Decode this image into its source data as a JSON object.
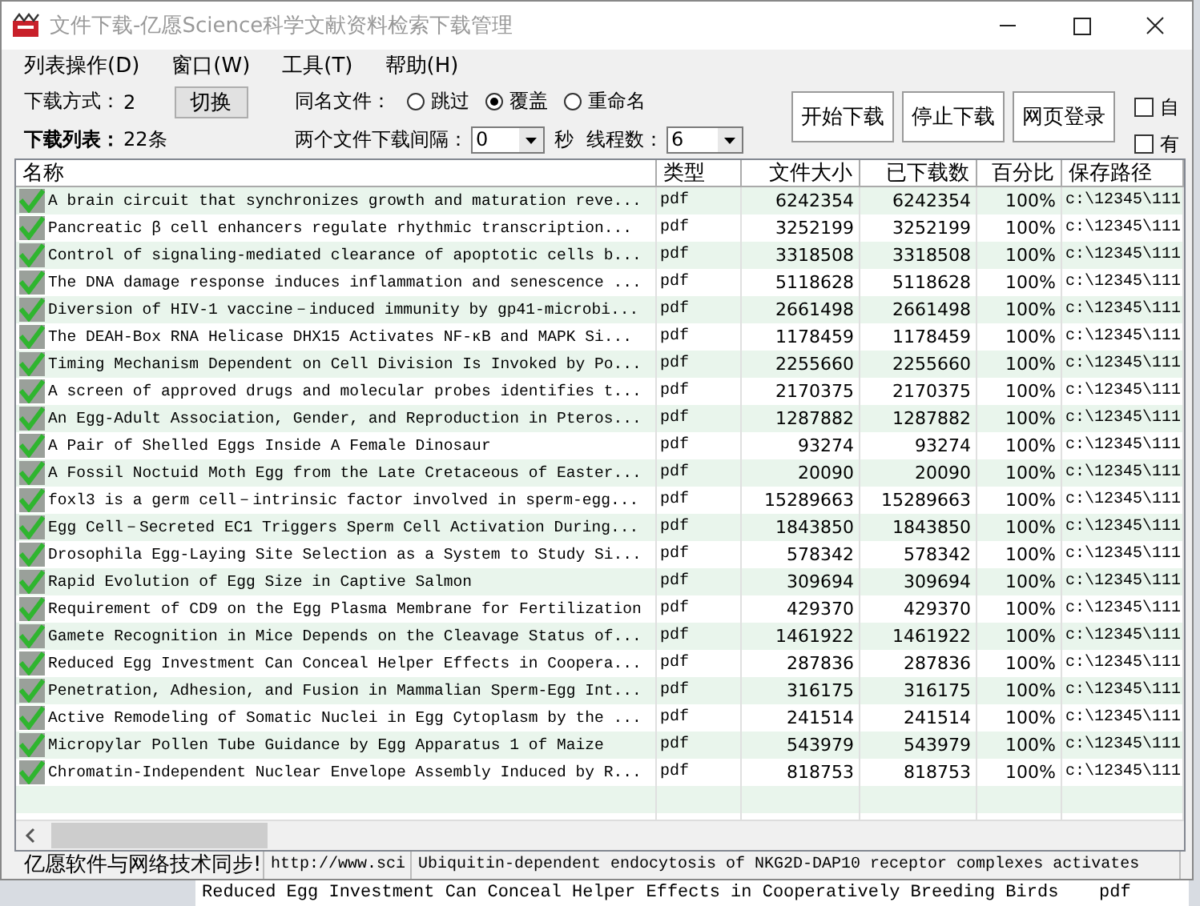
{
  "window": {
    "title": "文件下载-亿愿Science科学文献资料检索下载管理"
  },
  "menu": [
    "列表操作(D)",
    "窗口(W)",
    "工具(T)",
    "帮助(H)"
  ],
  "toolbar": {
    "mode_label": "下载方式：",
    "mode_value": "2",
    "switch_button": "切换",
    "list_label": "下载列表：",
    "list_count": "22条",
    "same_name_label": "同名文件：",
    "same_name_options": [
      {
        "label": "跳过",
        "selected": false
      },
      {
        "label": "覆盖",
        "selected": true
      },
      {
        "label": "重命名",
        "selected": false
      }
    ],
    "interval_label": "两个文件下载间隔：",
    "interval_value": "0",
    "seconds_label": "秒",
    "threads_label": "线程数：",
    "threads_value": "6",
    "buttons": [
      "开始下载",
      "停止下载",
      "网页登录"
    ],
    "checkboxes": [
      {
        "label": "自",
        "checked": false
      },
      {
        "label": "有",
        "checked": false
      }
    ]
  },
  "table": {
    "columns": [
      "名称",
      "类型",
      "文件大小",
      "已下载数",
      "百分比",
      "保存路径"
    ],
    "rows": [
      {
        "checked": true,
        "name": "A brain circuit that synchronizes growth and maturation reve...",
        "type": "pdf",
        "size": "6242354",
        "downloaded": "6242354",
        "percent": "100%",
        "path": "c:\\12345\\111"
      },
      {
        "checked": true,
        "name": "Pancreatic β cell enhancers regulate rhythmic transcription...",
        "type": "pdf",
        "size": "3252199",
        "downloaded": "3252199",
        "percent": "100%",
        "path": "c:\\12345\\111"
      },
      {
        "checked": true,
        "name": "Control of signaling-mediated clearance of apoptotic cells b...",
        "type": "pdf",
        "size": "3318508",
        "downloaded": "3318508",
        "percent": "100%",
        "path": "c:\\12345\\111"
      },
      {
        "checked": true,
        "name": "The DNA damage response induces inflammation and senescence ...",
        "type": "pdf",
        "size": "5118628",
        "downloaded": "5118628",
        "percent": "100%",
        "path": "c:\\12345\\111"
      },
      {
        "checked": true,
        "name": "Diversion of HIV-1 vaccine－induced immunity by gp41-microbi...",
        "type": "pdf",
        "size": "2661498",
        "downloaded": "2661498",
        "percent": "100%",
        "path": "c:\\12345\\111"
      },
      {
        "checked": true,
        "name": "The DEAH-Box RNA Helicase DHX15 Activates NF-κB and MAPK Si...",
        "type": "pdf",
        "size": "1178459",
        "downloaded": "1178459",
        "percent": "100%",
        "path": "c:\\12345\\111"
      },
      {
        "checked": true,
        "name": "Timing Mechanism Dependent on Cell Division Is Invoked by Po...",
        "type": "pdf",
        "size": "2255660",
        "downloaded": "2255660",
        "percent": "100%",
        "path": "c:\\12345\\111"
      },
      {
        "checked": true,
        "name": "A screen of approved drugs and molecular probes identifies t...",
        "type": "pdf",
        "size": "2170375",
        "downloaded": "2170375",
        "percent": "100%",
        "path": "c:\\12345\\111"
      },
      {
        "checked": true,
        "name": "An Egg-Adult Association, Gender, and Reproduction in Pteros...",
        "type": "pdf",
        "size": "1287882",
        "downloaded": "1287882",
        "percent": "100%",
        "path": "c:\\12345\\111"
      },
      {
        "checked": true,
        "name": "A Pair of Shelled Eggs Inside A Female Dinosaur",
        "type": "pdf",
        "size": "93274",
        "downloaded": "93274",
        "percent": "100%",
        "path": "c:\\12345\\111"
      },
      {
        "checked": true,
        "name": "A Fossil Noctuid Moth Egg from the Late Cretaceous of Easter...",
        "type": "pdf",
        "size": "20090",
        "downloaded": "20090",
        "percent": "100%",
        "path": "c:\\12345\\111"
      },
      {
        "checked": true,
        "name": "foxl3 is a germ cell－intrinsic factor involved in sperm-egg...",
        "type": "pdf",
        "size": "15289663",
        "downloaded": "15289663",
        "percent": "100%",
        "path": "c:\\12345\\111"
      },
      {
        "checked": true,
        "name": "Egg Cell－Secreted EC1 Triggers Sperm Cell Activation During...",
        "type": "pdf",
        "size": "1843850",
        "downloaded": "1843850",
        "percent": "100%",
        "path": "c:\\12345\\111"
      },
      {
        "checked": true,
        "name": "Drosophila Egg-Laying Site Selection as a System to Study Si...",
        "type": "pdf",
        "size": "578342",
        "downloaded": "578342",
        "percent": "100%",
        "path": "c:\\12345\\111"
      },
      {
        "checked": true,
        "name": "Rapid Evolution of Egg Size in Captive Salmon",
        "type": "pdf",
        "size": "309694",
        "downloaded": "309694",
        "percent": "100%",
        "path": "c:\\12345\\111"
      },
      {
        "checked": true,
        "name": "Requirement of CD9 on the Egg Plasma Membrane for Fertilization",
        "type": "pdf",
        "size": "429370",
        "downloaded": "429370",
        "percent": "100%",
        "path": "c:\\12345\\111"
      },
      {
        "checked": true,
        "name": "Gamete Recognition in Mice Depends on the Cleavage Status of...",
        "type": "pdf",
        "size": "1461922",
        "downloaded": "1461922",
        "percent": "100%",
        "path": "c:\\12345\\111"
      },
      {
        "checked": true,
        "name": "Reduced Egg Investment Can Conceal Helper Effects in Coopera...",
        "type": "pdf",
        "size": "287836",
        "downloaded": "287836",
        "percent": "100%",
        "path": "c:\\12345\\111"
      },
      {
        "checked": true,
        "name": "Penetration, Adhesion, and Fusion in Mammalian Sperm-Egg Int...",
        "type": "pdf",
        "size": "316175",
        "downloaded": "316175",
        "percent": "100%",
        "path": "c:\\12345\\111"
      },
      {
        "checked": true,
        "name": "Active Remodeling of Somatic Nuclei in Egg Cytoplasm by the ...",
        "type": "pdf",
        "size": "241514",
        "downloaded": "241514",
        "percent": "100%",
        "path": "c:\\12345\\111"
      },
      {
        "checked": true,
        "name": "Micropylar Pollen Tube Guidance by Egg Apparatus 1 of Maize",
        "type": "pdf",
        "size": "543979",
        "downloaded": "543979",
        "percent": "100%",
        "path": "c:\\12345\\111"
      },
      {
        "checked": true,
        "name": "Chromatin-Independent Nuclear Envelope Assembly Induced by R...",
        "type": "pdf",
        "size": "818753",
        "downloaded": "818753",
        "percent": "100%",
        "path": "c:\\12345\\111"
      }
    ]
  },
  "status_bar": [
    "亿愿软件与网络技术同步!",
    "http://www.sci",
    "Ubiquitin-dependent endocytosis of NKG2D-DAP10 receptor complexes activates"
  ],
  "background_window": {
    "name": "Reduced Egg Investment Can Conceal Helper Effects in Cooperatively Breeding Birds",
    "type": "pdf"
  }
}
